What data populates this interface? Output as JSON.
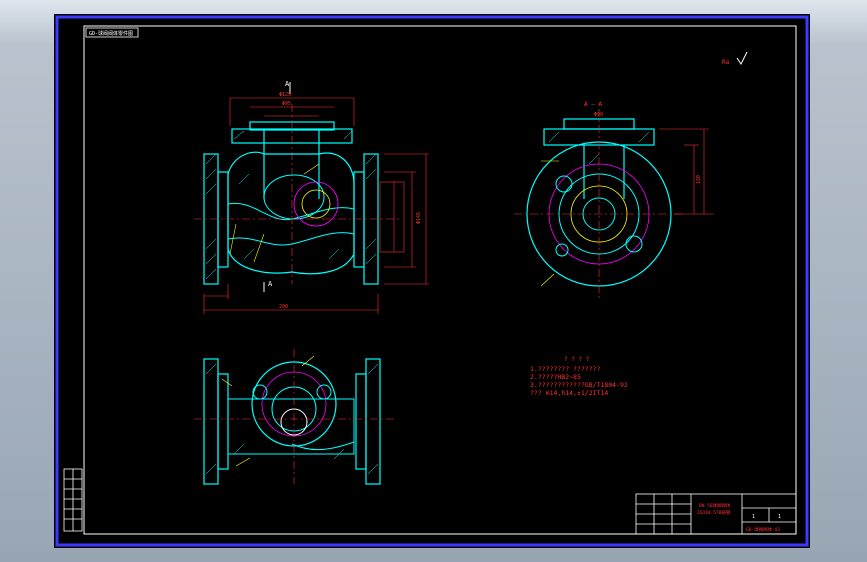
{
  "sheet_code": "GD-球阀阀体零件图",
  "section_label_a": "A",
  "section_label_a_side": "A — A",
  "roughness_corner": "Ra",
  "notes": {
    "title": "? ? ? ?",
    "lines": [
      "1.???????? ???????",
      "2.?????HB2~85",
      "3.????????????GB/T1804-92",
      "  ??? m14,h14,±1/2IT14"
    ]
  },
  "title_block": {
    "part_name_1": "DN 50球阀阀体",
    "part_name_2": "ZG310-570铸钢",
    "drawing_no": "GD-球阀阀体-01",
    "scale_a": "1",
    "scale_b": "1"
  },
  "dimensions": {
    "top_width": "Φ125",
    "inner_width": "Φ95",
    "flange_height": "Φ145",
    "bottom_length": "200",
    "side_height": "180",
    "side_top": "Φ90"
  }
}
